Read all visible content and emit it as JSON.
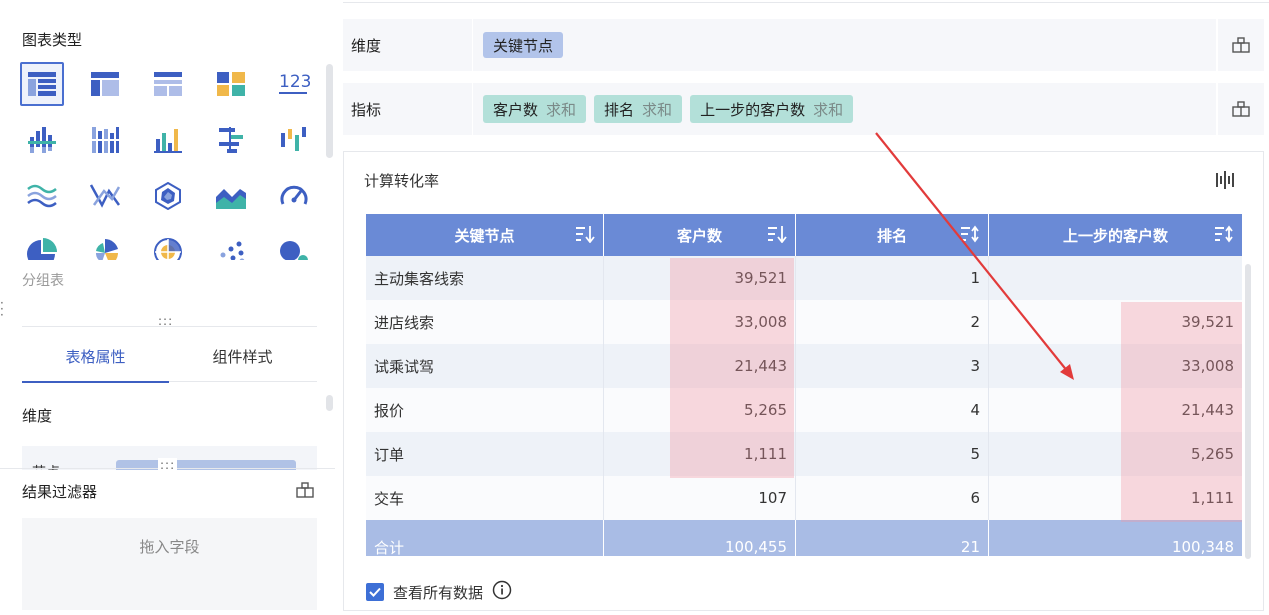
{
  "left": {
    "chart_type_title": "图表类型",
    "chart_icons": [
      "group-table-icon",
      "cross-table-icon",
      "detail-table-icon",
      "kpi-card-icon",
      "number-icon",
      "grouped-bar-icon",
      "stacked-bar-icon",
      "column-icon",
      "horizontal-bar-icon",
      "waterfall-icon",
      "line-icon",
      "range-icon",
      "radar-icon",
      "area-icon",
      "gauge-icon",
      "pie-icon",
      "rose-icon",
      "polar-icon",
      "scatter-icon",
      "bubble-icon"
    ],
    "selected_chart_label": "分组表",
    "number_icon_text": "123",
    "tabs": [
      "表格属性",
      "组件样式"
    ],
    "dimension_title": "维度",
    "dimension_row_label": "节点",
    "filter_title": "结果过滤器",
    "drop_zone_text": "拖入字段"
  },
  "fields": {
    "dimension_label": "维度",
    "dimension_pills": [
      "关键节点"
    ],
    "metric_label": "指标",
    "metric_pills": [
      {
        "name": "客户数",
        "agg": "求和"
      },
      {
        "name": "排名",
        "agg": "求和"
      },
      {
        "name": "上一步的客户数",
        "agg": "求和"
      }
    ]
  },
  "card": {
    "title": "计算转化率",
    "check_label": "查看所有数据"
  },
  "table": {
    "headers": [
      "关键节点",
      "客户数",
      "排名",
      "上一步的客户数"
    ],
    "rows": [
      [
        "主动集客线索",
        "39,521",
        "1",
        ""
      ],
      [
        "进店线索",
        "33,008",
        "2",
        "39,521"
      ],
      [
        "试乘试驾",
        "21,443",
        "3",
        "33,008"
      ],
      [
        "报价",
        "5,265",
        "4",
        "21,443"
      ],
      [
        "订单",
        "1,111",
        "5",
        "5,265"
      ],
      [
        "交车",
        "107",
        "6",
        "1,111"
      ]
    ],
    "total": [
      "合计",
      "100,455",
      "21",
      "100,348"
    ]
  },
  "colors": {
    "header_bg": "#6a8ad6",
    "total_bg": "#a9bce5",
    "dimension_pill": "#b2c4ea",
    "metric_pill": "#b3e0d9",
    "highlight": "#f5c6cc",
    "arrow": "#e23b3b",
    "accent": "#3d5fc2"
  }
}
